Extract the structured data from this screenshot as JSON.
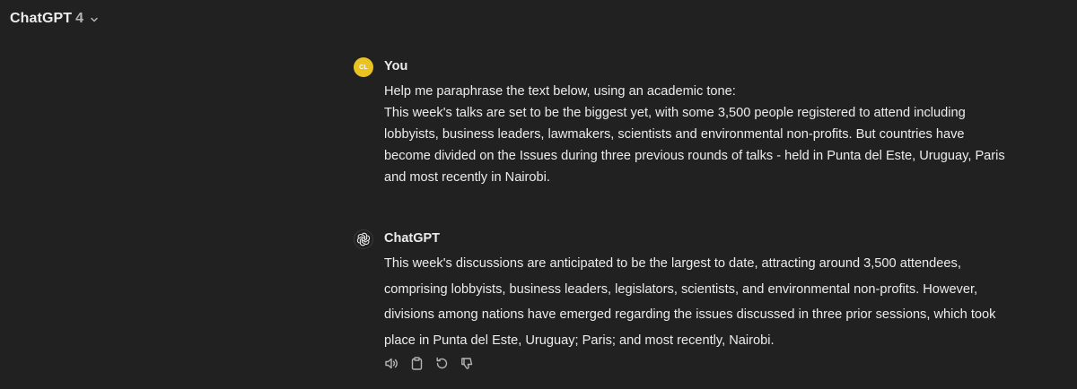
{
  "header": {
    "model_name": "ChatGPT",
    "model_version": "4"
  },
  "conversation": {
    "user_message": {
      "avatar_initials": "CL",
      "author": "You",
      "lines": [
        "Help me paraphrase the text below, using an academic tone:",
        "This week's talks are set to be the biggest yet, with some 3,500 people registered to attend including lobbyists, business leaders, lawmakers, scientists and environmental non-profits. But countries have become divided on the Issues during three previous rounds of talks - held in Punta del Este, Uruguay, Paris and most recently in Nairobi."
      ]
    },
    "assistant_message": {
      "author": "ChatGPT",
      "text": "This week's discussions are anticipated to be the largest to date, attracting around 3,500 attendees, comprising lobbyists, business leaders, legislators, scientists, and environmental non-profits. However, divisions among nations have emerged regarding the issues discussed in three prior sessions, which took place in Punta del Este, Uruguay; Paris; and most recently, Nairobi."
    }
  },
  "actions": [
    "read-aloud-icon",
    "copy-icon",
    "regenerate-icon",
    "thumbs-down-icon"
  ],
  "colors": {
    "background": "#212121",
    "text": "#ececec",
    "user_avatar": "#e8c322",
    "icon": "#b4b4b4"
  }
}
